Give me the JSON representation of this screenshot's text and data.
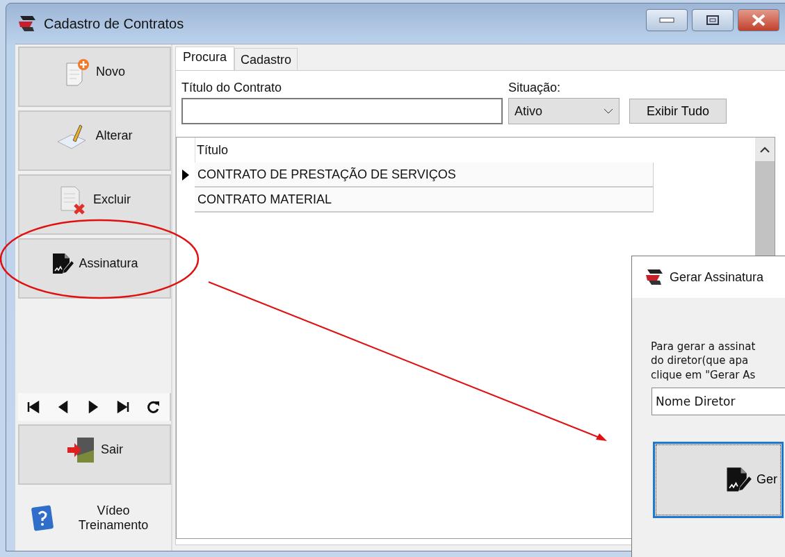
{
  "window": {
    "title": "Cadastro de Contratos"
  },
  "sidebar": {
    "buttons": [
      {
        "label": "Novo"
      },
      {
        "label": "Alterar"
      },
      {
        "label": "Excluir"
      },
      {
        "label": "Assinatura"
      }
    ],
    "exit_button": {
      "label": "Sair"
    },
    "video_link": {
      "label": "Vídeo Treinamento"
    }
  },
  "tabs": [
    {
      "label": "Procura",
      "selected": true
    },
    {
      "label": "Cadastro",
      "selected": false
    }
  ],
  "search": {
    "title_label": "Título do Contrato",
    "status_label": "Situação:",
    "status_value": "Ativo",
    "show_all_button": "Exibir Tudo"
  },
  "table": {
    "columns": [
      "Título"
    ],
    "rows": [
      {
        "cells": [
          "CONTRATO DE PRESTAÇÃO DE SERVIÇOS"
        ],
        "selected": true
      },
      {
        "cells": [
          "CONTRATO MATERIAL"
        ],
        "selected": false
      }
    ]
  },
  "dialog": {
    "title": "Gerar Assinatura",
    "message": "Para gerar a assinat\ndo diretor(que apa\nclique em \"Gerar As",
    "name_field": {
      "value": "Nome Diretor"
    },
    "generate_button": "Ger"
  }
}
